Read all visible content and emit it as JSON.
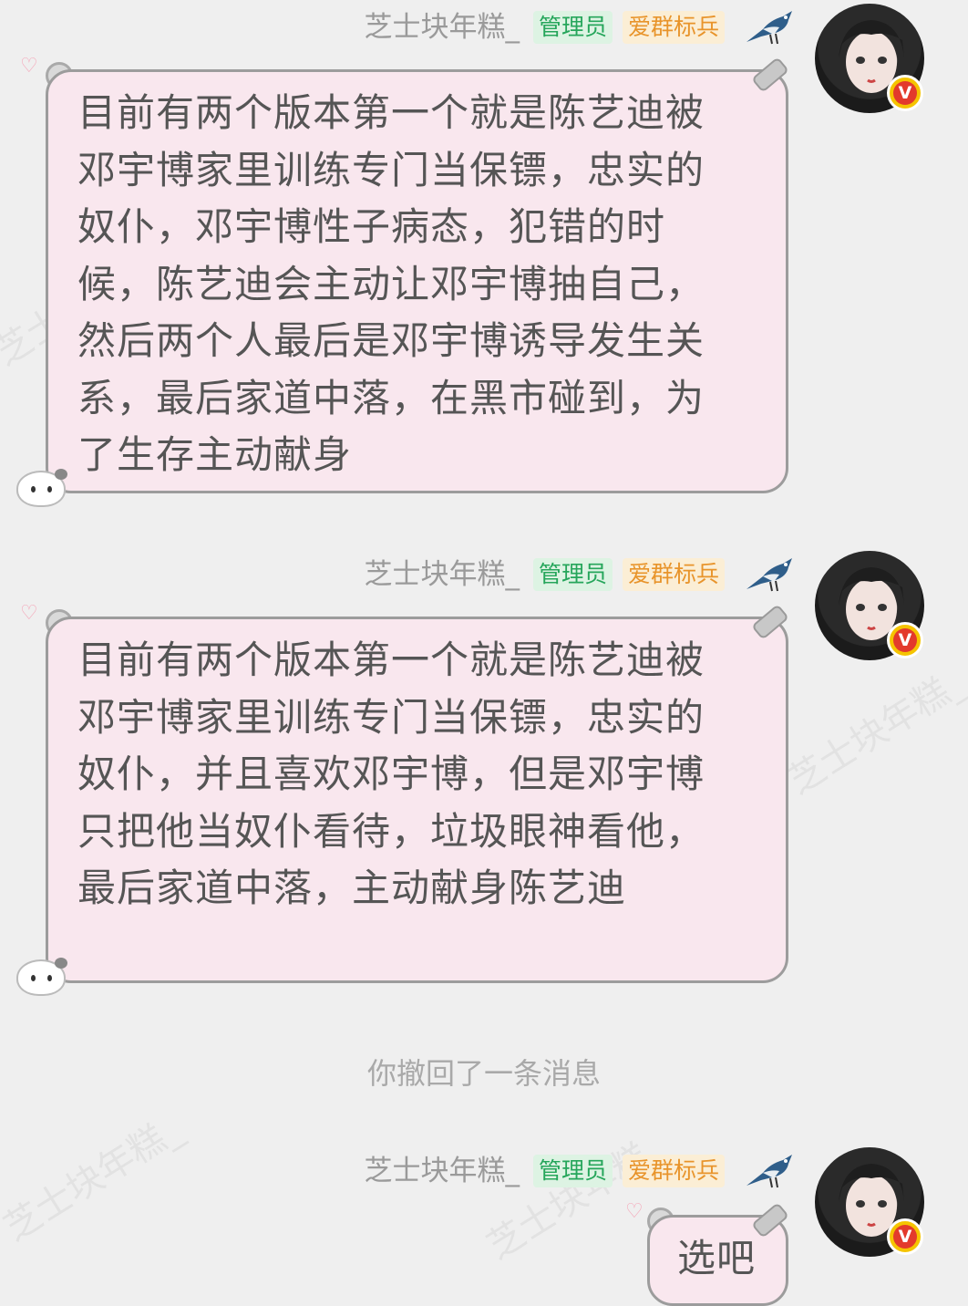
{
  "watermark": {
    "text": "芝士块年糕_"
  },
  "messages": [
    {
      "nickname": "芝士块年糕_",
      "tag_admin": "管理员",
      "tag_fans": "爱群标兵",
      "text": "目前有两个版本第一个就是陈艺迪被邓宇博家里训练专门当保镖，忠实的奴仆，邓宇博性子病态，犯错的时候，陈艺迪会主动让邓宇博抽自己，然后两个人最后是邓宇博诱导发生关系，最后家道中落，在黑市碰到，为了生存主动献身"
    },
    {
      "nickname": "芝士块年糕_",
      "tag_admin": "管理员",
      "tag_fans": "爱群标兵",
      "text": "目前有两个版本第一个就是陈艺迪被邓宇博家里训练专门当保镖，忠实的奴仆，并且喜欢邓宇博，但是邓宇博只把他当奴仆看待，垃圾眼神看他，最后家道中落，主动献身陈艺迪"
    },
    {
      "nickname": "芝士块年糕_",
      "tag_admin": "管理员",
      "tag_fans": "爱群标兵",
      "text": "选吧"
    }
  ],
  "system": {
    "recall": "你撤回了一条消息"
  },
  "avatar_badge": "V",
  "colors": {
    "bubble_bg": "#f9e7ee",
    "bubble_border": "#9c9c9c",
    "admin_tag": "#26a65b",
    "fans_tag": "#e8942b",
    "badge_yellow": "#f5c400",
    "badge_red": "#e33a2c"
  }
}
